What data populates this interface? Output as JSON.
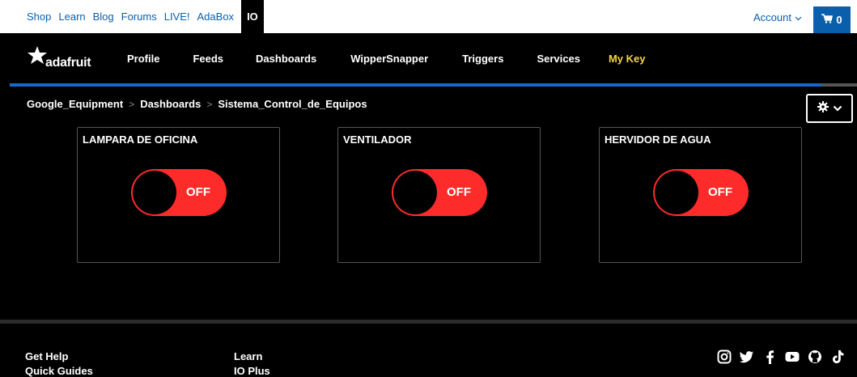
{
  "top_links": [
    "Shop",
    "Learn",
    "Blog",
    "Forums",
    "LIVE!",
    "AdaBox",
    "IO"
  ],
  "account": "Account",
  "cart_count": "0",
  "logo_text": "adafruit",
  "nav": [
    "Profile",
    "Feeds",
    "Dashboards",
    "WipperSnapper",
    "Triggers",
    "Services",
    "My Key"
  ],
  "breadcrumb": [
    "Google_Equipment",
    "Dashboards",
    "Sistema_Control_de_Equipos"
  ],
  "blocks": [
    {
      "title": "LAMPARA DE OFICINA",
      "state": "OFF"
    },
    {
      "title": "VENTILADOR",
      "state": "OFF"
    },
    {
      "title": "HERVIDOR DE AGUA",
      "state": "OFF"
    }
  ],
  "footer": {
    "col1": [
      "Get Help",
      "Quick Guides"
    ],
    "col2": [
      "Learn",
      "IO Plus"
    ]
  },
  "social_icons": [
    "instagram-icon",
    "twitter-icon",
    "facebook-icon",
    "youtube-icon",
    "github-icon",
    "tiktok-icon"
  ],
  "colors": {
    "link": "#0a5fad",
    "accent_blue": "#1769c7",
    "toggle_off": "#fe2b2b",
    "my_key": "#f7d443"
  }
}
